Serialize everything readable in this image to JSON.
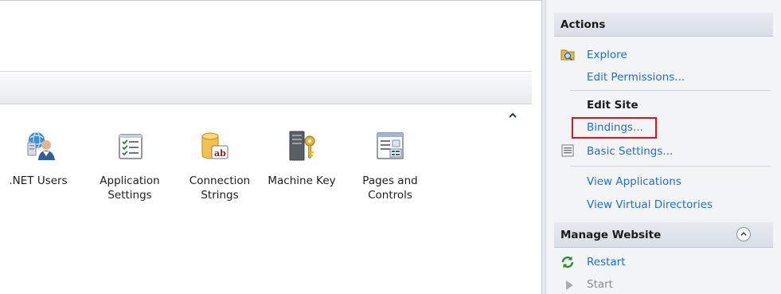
{
  "features": [
    {
      "id": "net-users",
      "label": ".NET Users",
      "icon": "users-globe-icon"
    },
    {
      "id": "application-settings",
      "label": "Application\nSettings",
      "icon": "settings-list-icon"
    },
    {
      "id": "connection-strings",
      "label": "Connection\nStrings",
      "icon": "database-ab-icon"
    },
    {
      "id": "machine-key",
      "label": "Machine Key",
      "icon": "server-key-icon"
    },
    {
      "id": "pages-and-controls",
      "label": "Pages and\nControls",
      "icon": "page-controls-icon"
    }
  ],
  "actions": {
    "header": "Actions",
    "explore": "Explore",
    "edit_permissions": "Edit Permissions...",
    "edit_site_title": "Edit Site",
    "bindings": "Bindings...",
    "basic_settings": "Basic Settings...",
    "view_applications": "View Applications",
    "view_virtual_directories": "View Virtual Directories",
    "manage_website_title": "Manage Website",
    "restart": "Restart",
    "start": "Start"
  },
  "colors": {
    "link": "#1f6fcf",
    "highlight": "#e0141e",
    "disabled": "#8a8a8a"
  }
}
